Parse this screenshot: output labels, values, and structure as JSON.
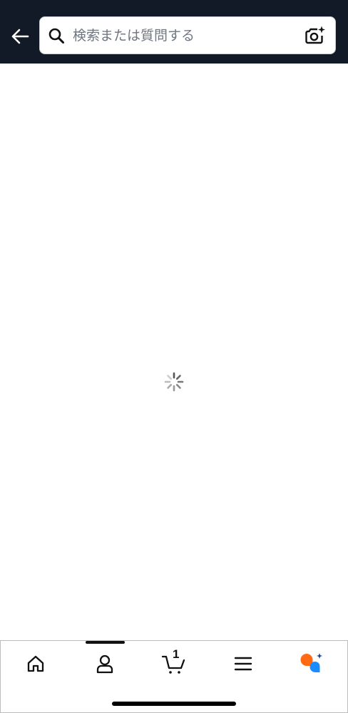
{
  "header": {
    "back_icon": "arrow-left-icon",
    "search": {
      "placeholder": "検索または質問する",
      "value": "",
      "icon": "search-icon",
      "camera_icon": "camera-sparkle-icon"
    }
  },
  "main": {
    "loading_icon": "spinner-icon"
  },
  "bottom_nav": {
    "active_tab": "account",
    "items": [
      {
        "id": "home",
        "icon": "home-icon"
      },
      {
        "id": "account",
        "icon": "user-icon"
      },
      {
        "id": "cart",
        "icon": "cart-icon",
        "count": "1"
      },
      {
        "id": "menu",
        "icon": "hamburger-menu-icon"
      },
      {
        "id": "assistant",
        "icon": "ai-assistant-icon"
      }
    ]
  },
  "colors": {
    "header_bg": "#131a27",
    "assistant_orange": "#ff6a13",
    "assistant_blue": "#1a8cff"
  }
}
